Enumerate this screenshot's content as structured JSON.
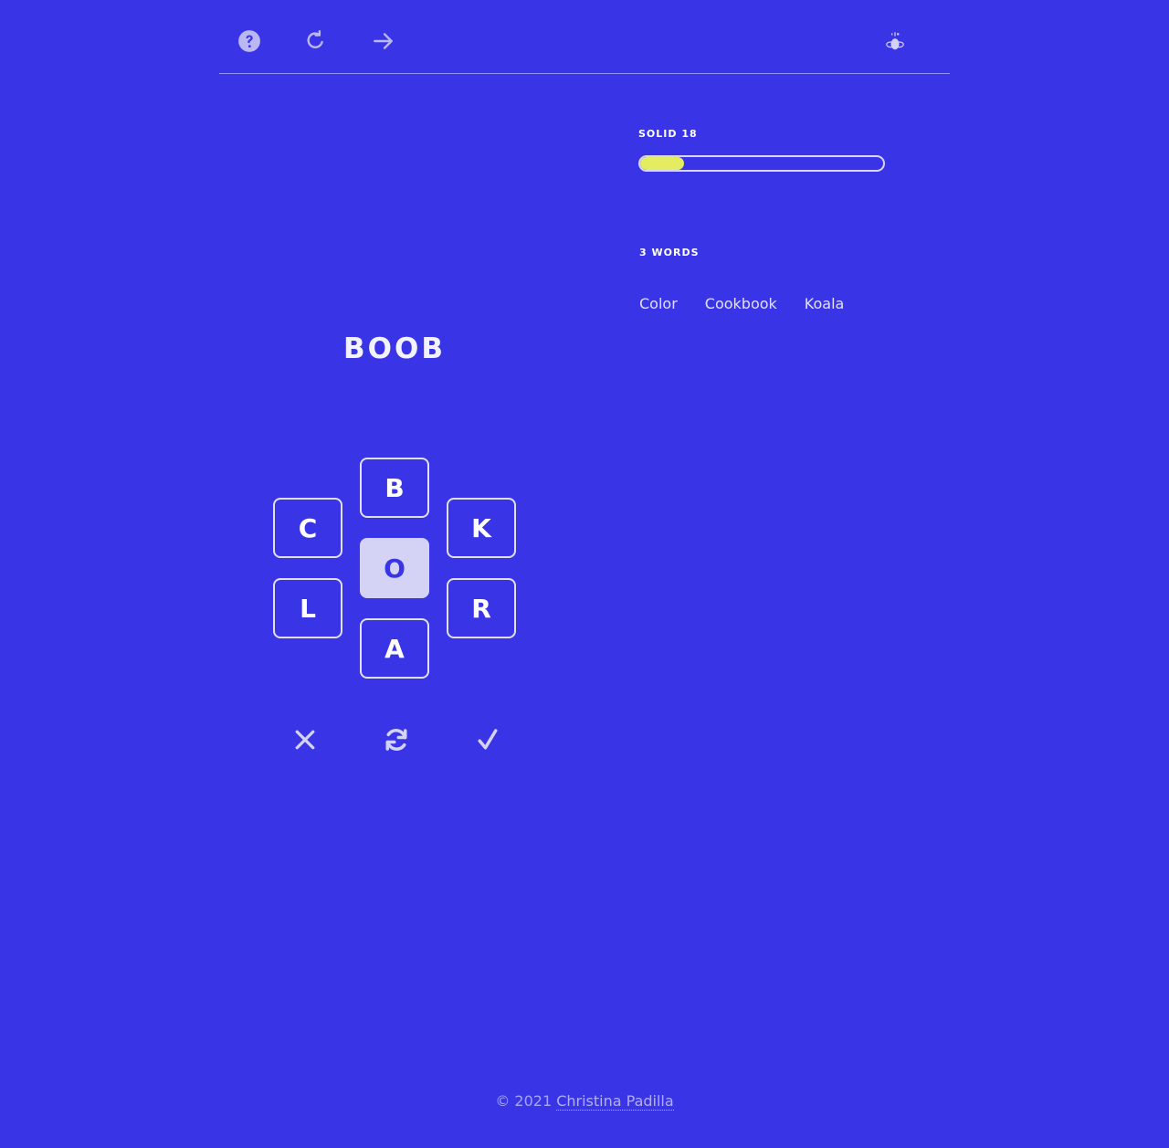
{
  "header": {
    "help_icon": "question-circle-icon",
    "restart_icon": "rotate-icon",
    "next_icon": "arrow-right-icon",
    "logo_icon": "bee-logo-icon"
  },
  "stats": {
    "rank_label": "SOLID 18",
    "progress": 0.18,
    "progress_color": "#e4ec61",
    "words_count_label": "3 WORDS",
    "found_words": [
      "Color",
      "Cookbook",
      "Koala"
    ]
  },
  "game": {
    "current_word": "BOOB",
    "tiles": {
      "top": "B",
      "upper_left": "C",
      "upper_right": "K",
      "center": "O",
      "lower_left": "L",
      "lower_right": "R",
      "bottom": "A"
    },
    "actions": {
      "delete_icon": "x-icon",
      "shuffle_icon": "shuffle-icon",
      "enter_icon": "check-icon"
    }
  },
  "footer": {
    "copyright": "© 2021",
    "author": "Christina Padilla"
  },
  "colors": {
    "background": "#3935e6",
    "center_tile": "#d4d3f5",
    "text": "#ffffff"
  }
}
